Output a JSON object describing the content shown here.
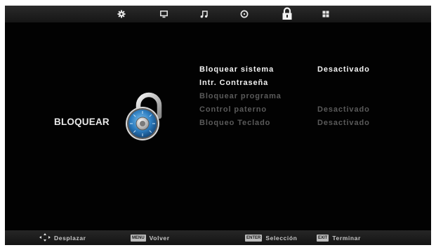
{
  "top_tabs": [
    {
      "icon": "gear-icon",
      "active": false
    },
    {
      "icon": "monitor-icon",
      "active": false
    },
    {
      "icon": "music-note-icon",
      "active": false
    },
    {
      "icon": "clock-icon",
      "active": false
    },
    {
      "icon": "padlock-icon",
      "active": true
    },
    {
      "icon": "grid-icon",
      "active": false
    }
  ],
  "panel": {
    "title": "BLOQUEAR",
    "icon": "combination-lock-icon"
  },
  "menu": {
    "items": [
      {
        "label": "Bloquear sistema",
        "value": "Desactivado",
        "state": "active"
      },
      {
        "label": "Intr. Contraseña",
        "value": "",
        "state": "normal"
      },
      {
        "label": "Bloquear programa",
        "value": "",
        "state": "disabled"
      },
      {
        "label": "Control paterno",
        "value": "Desactivado",
        "state": "disabled"
      },
      {
        "label": "Bloqueo Teclado",
        "value": "Desactivado",
        "state": "disabled"
      }
    ]
  },
  "footer": {
    "navigate": {
      "icon": "dpad-arrows-icon",
      "label": "Desplazar"
    },
    "back": {
      "key": "MENU",
      "label": "Volver"
    },
    "select": {
      "key": "ENTER",
      "label": "Selección"
    },
    "exit": {
      "key": "EXIT",
      "label": "Terminar"
    }
  },
  "colors": {
    "background": "#020202",
    "text_active": "#f4f4f4",
    "text_disabled": "#5a5a5a",
    "lock_blue": "#3a8fd0"
  }
}
